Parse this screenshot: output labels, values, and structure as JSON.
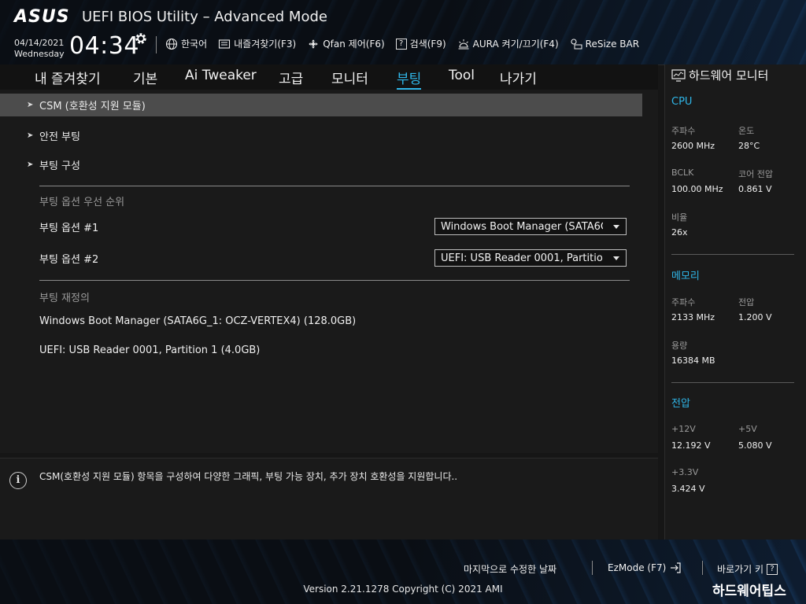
{
  "header": {
    "logo": "ASUS",
    "title": "UEFI BIOS Utility – Advanced Mode",
    "date": "04/14/2021",
    "weekday": "Wednesday",
    "time": "04:34",
    "toolbar": [
      {
        "label": "한국어",
        "icon": "globe-icon"
      },
      {
        "label": "내즐겨찾기(F3)",
        "icon": "favorites-icon"
      },
      {
        "label": "Qfan 제어(F6)",
        "icon": "fan-icon"
      },
      {
        "label": "검색(F9)",
        "icon": "search-help-icon"
      },
      {
        "label": "AURA 켜기/끄기(F4)",
        "icon": "aura-light-icon"
      },
      {
        "label": "ReSize BAR",
        "icon": "resize-bar-icon"
      }
    ]
  },
  "nav": {
    "tabs": [
      {
        "label": "내 즐겨찾기",
        "active": false
      },
      {
        "label": "기본",
        "active": false
      },
      {
        "label": "Ai Tweaker",
        "active": false
      },
      {
        "label": "고급",
        "active": false
      },
      {
        "label": "모니터",
        "active": false
      },
      {
        "label": "부팅",
        "active": true
      },
      {
        "label": "Tool",
        "active": false
      },
      {
        "label": "나가기",
        "active": false
      }
    ]
  },
  "main": {
    "menu_items": [
      {
        "label": "CSM (호환성 지원 모듈)",
        "selected": true
      },
      {
        "label": "안전 부팅",
        "selected": false
      },
      {
        "label": "부팅 구성",
        "selected": false
      }
    ],
    "boot_priority_label": "부팅 옵션 우선 순위",
    "boot_options": [
      {
        "label": "부팅 옵션 #1",
        "value": "Windows Boot Manager (SATA6G"
      },
      {
        "label": "부팅 옵션 #2",
        "value": "UEFI:  USB Reader 0001, Partitio"
      }
    ],
    "boot_override_label": "부팅 재정의",
    "boot_override_items": [
      "Windows Boot Manager (SATA6G_1: OCZ-VERTEX4) (128.0GB)",
      "UEFI:  USB Reader 0001, Partition 1 (4.0GB)"
    ]
  },
  "help": {
    "icon_letter": "i",
    "text": "CSM(호환성 지원 모듈) 항목을 구성하여 다양한 그래픽, 부팅 가능 장치, 추가 장치 호환성을 지원합니다.."
  },
  "hw_monitor": {
    "title": "하드웨어 모니터",
    "cpu": {
      "heading": "CPU",
      "freq_label": "주파수",
      "freq": "2600 MHz",
      "temp_label": "온도",
      "temp": "28°C",
      "bclk_label": "BCLK",
      "bclk": "100.00 MHz",
      "vcore_label": "코어 전압",
      "vcore": "0.861 V",
      "ratio_label": "비율",
      "ratio": "26x"
    },
    "memory": {
      "heading": "메모리",
      "freq_label": "주파수",
      "freq": "2133 MHz",
      "volt_label": "전압",
      "volt": "1.200 V",
      "cap_label": "용량",
      "cap": "16384 MB"
    },
    "voltage": {
      "heading": "전압",
      "v12_label": "+12V",
      "v12": "12.192 V",
      "v5_label": "+5V",
      "v5": "5.080 V",
      "v33_label": "+3.3V",
      "v33": "3.424 V"
    }
  },
  "footer": {
    "last_modified": "마지막으로 수정한 날짜",
    "ezmode": "EzMode (F7)",
    "hotkeys": "바로가기 키",
    "hotkeys_icon": "?",
    "version": "Version 2.21.1278 Copyright (C) 2021 AMI",
    "watermark": "하드웨어팁스"
  },
  "colors": {
    "accent": "#2fb6e8",
    "selected_row": "#4c4c4c",
    "background": "#161616"
  }
}
